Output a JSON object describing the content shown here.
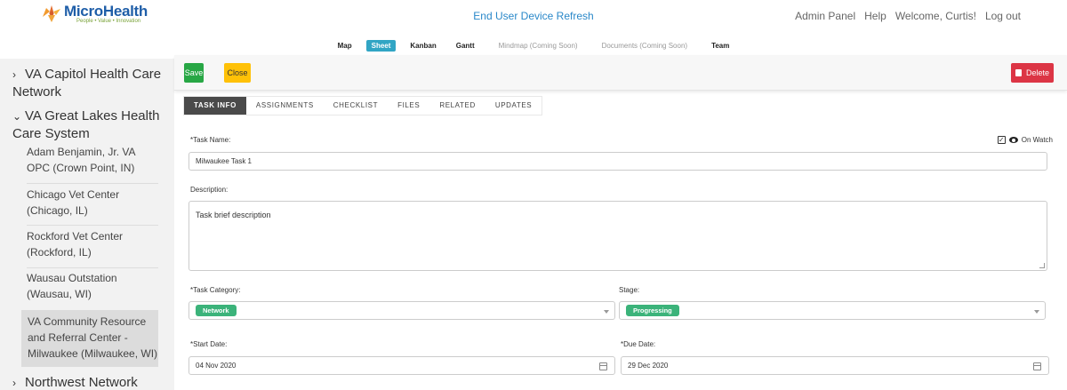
{
  "header": {
    "logo_name": "MicroHealth",
    "logo_tagline": "People • Value • Innovation",
    "project_title": "End User Device Refresh",
    "links": [
      "Admin Panel",
      "Help",
      "Welcome, Curtis!",
      "Log out"
    ]
  },
  "nav": {
    "tabs": [
      "Map",
      "Sheet",
      "Kanban",
      "Gantt",
      "Mindmap (Coming Soon)",
      "Documents (Coming Soon)",
      "Team"
    ],
    "active": "Sheet"
  },
  "sidebar": {
    "groups": [
      {
        "label": "VA Capitol Health Care Network",
        "expanded": false
      },
      {
        "label": "VA Great Lakes Health Care System",
        "expanded": true
      },
      {
        "label": "Northwest Network",
        "expanded": false
      }
    ],
    "items": [
      {
        "label": "Adam Benjamin, Jr. VA OPC (Crown Point, IN)"
      },
      {
        "label": "Chicago Vet Center (Chicago, IL)"
      },
      {
        "label": "Rockford Vet Center (Rockford, IL)"
      },
      {
        "label": "Wausau Outstation (Wausau, WI)"
      },
      {
        "label": "VA Community Resource and Referral Center - Milwaukee (Milwaukee, WI)"
      }
    ],
    "chevron_collapsed": "›",
    "chevron_expanded": "⌄"
  },
  "actions": {
    "save": "Save",
    "close": "Close",
    "delete": "Delete"
  },
  "task_tabs": [
    "TASK INFO",
    "ASSIGNMENTS",
    "CHECKLIST",
    "FILES",
    "RELATED",
    "UPDATES"
  ],
  "form": {
    "task_name_label": "*Task Name:",
    "task_name_value": "Milwaukee Task 1",
    "on_watch_label": "On Watch",
    "on_watch_checked": true,
    "description_label": "Description:",
    "description_value": "Task brief description",
    "category_label": "*Task Category:",
    "category_value": "Network",
    "stage_label": "Stage:",
    "stage_value": "Progressing",
    "start_date_label": "*Start Date:",
    "start_date_value": "04 Nov 2020",
    "due_date_label": "*Due Date:",
    "due_date_value": "29 Dec 2020"
  },
  "colors": {
    "brand_blue": "#1f5ea8",
    "accent_teal": "#31a5c4",
    "save_green": "#28a745",
    "close_yellow": "#ffc107",
    "delete_red": "#dc3545",
    "pill_green": "#3bb37a"
  }
}
